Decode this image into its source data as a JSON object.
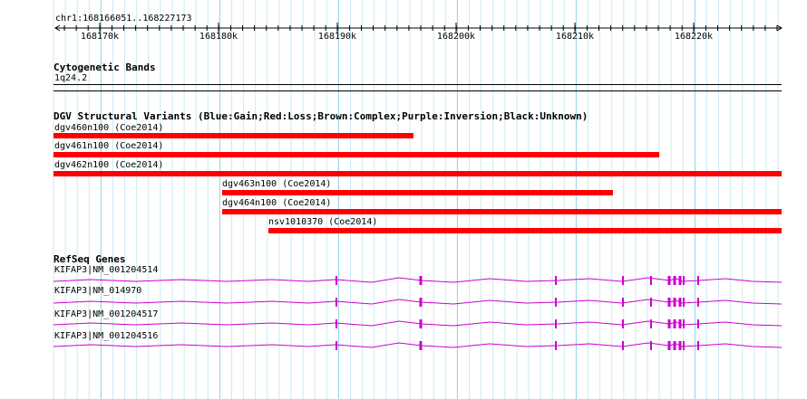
{
  "ruler": {
    "coordinates": "chr1:168166051..168227173",
    "ticks": [
      {
        "label": "168170k"
      },
      {
        "label": "168180k"
      },
      {
        "label": "168190k"
      },
      {
        "label": "168200k"
      },
      {
        "label": "168210k"
      },
      {
        "label": "168220k"
      }
    ]
  },
  "cytoband": {
    "title": "Cytogenetic Bands",
    "band": "1q24.2"
  },
  "dgv": {
    "title": "DGV Structural Variants (Blue:Gain;Red:Loss;Brown:Complex;Purple:Inversion;Black:Unknown)",
    "color": "#ff0000",
    "variants": [
      {
        "label": "dgv460n100 (Coe2014)"
      },
      {
        "label": "dgv461n100 (Coe2014)"
      },
      {
        "label": "dgv462n100 (Coe2014)"
      },
      {
        "label": "dgv463n100 (Coe2014)"
      },
      {
        "label": "dgv464n100 (Coe2014)"
      },
      {
        "label": "nsv1010370 (Coe2014)"
      }
    ]
  },
  "refseq": {
    "title": "RefSeq Genes",
    "color": "#cc00cc",
    "genes": [
      {
        "label": "KIFAP3|NM_001204514"
      },
      {
        "label": "KIFAP3|NM_014970"
      },
      {
        "label": "KIFAP3|NM_001204517"
      },
      {
        "label": "KIFAP3|NM_001204516"
      }
    ]
  }
}
